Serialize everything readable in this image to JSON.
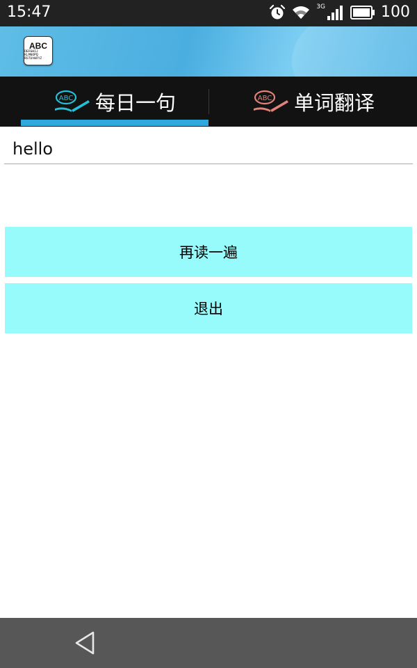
{
  "status_bar": {
    "time": "15:47",
    "network": "3G",
    "battery": "100",
    "icons": [
      "alarm-icon",
      "wifi-icon",
      "signal-icon",
      "battery-icon"
    ]
  },
  "app": {
    "logo_text": "ABC",
    "logo_subtext": "DEFGHIJ KLMNOPQ RSTUVWXYZ"
  },
  "tabs": [
    {
      "label": "每日一句",
      "icon": "abc-book-icon",
      "icon_color": "#26c0d6",
      "selected": true
    },
    {
      "label": "单词翻译",
      "icon": "abc-book-icon",
      "icon_color": "#e1837a",
      "selected": false
    }
  ],
  "input": {
    "value": "hello"
  },
  "buttons": {
    "replay_label": "再读一遍",
    "exit_label": "退出"
  },
  "nav": {
    "back_icon": "back-triangle-icon"
  },
  "colors": {
    "header_blue": "#4aaee0",
    "tab_indicator": "#2fa9dd",
    "button_bg": "#98fbfb",
    "nav_bg": "#575757"
  }
}
